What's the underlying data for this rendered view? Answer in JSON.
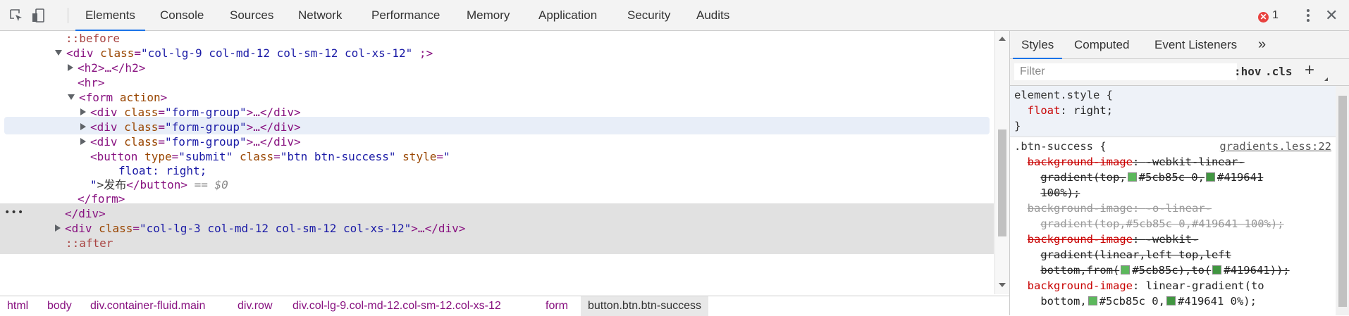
{
  "toolbar": {
    "tabs": [
      "Elements",
      "Console",
      "Sources",
      "Network",
      "Performance",
      "Memory",
      "Application",
      "Security",
      "Audits"
    ],
    "error_count": "1",
    "close_glyph": "✕"
  },
  "tree": {
    "lines": {
      "before": "::before",
      "div_main_tag": "<div",
      "div_main_attr": "class",
      "div_main_val": "\"col-lg-9 col-md-12 col-sm-12 col-xs-12\"",
      "div_main_tail": " ;>",
      "h2": "<h2>…</h2>",
      "hr": "<hr>",
      "form_tag": "<form",
      "form_attr": "action",
      "form_close": ">",
      "fg_open": "<div",
      "fg_attr": "class",
      "fg_val": "\"form-group\"",
      "fg_tail": ">…</div>",
      "btn_tag": "<button",
      "btn_type_attr": "type",
      "btn_type_val": "\"submit\"",
      "btn_class_attr": "class",
      "btn_class_val": "\"btn btn-success\"",
      "btn_style_attr": "style",
      "btn_style_open": "\"",
      "btn_style_body": "float: right;",
      "btn_style_close": "\"",
      "btn_text": ">发布",
      "btn_end": "</button>",
      "btn_eq": " == $0",
      "form_end": "</form>",
      "div_end": "</div>",
      "div2_tag": "<div",
      "div2_attr": "class",
      "div2_val": "\"col-lg-3 col-md-12 col-sm-12 col-xs-12\"",
      "div2_tail": ">…</div>",
      "after": "::after"
    }
  },
  "breadcrumb": [
    "html",
    "body",
    "div.container-fluid.main",
    "div.row",
    "div.col-lg-9.col-md-12.col-sm-12.col-xs-12",
    "form",
    "button.btn.btn-success"
  ],
  "styles": {
    "tabs": [
      "Styles",
      "Computed",
      "Event Listeners"
    ],
    "more": "»",
    "filter_placeholder": "Filter",
    "hov": ":hov",
    "cls": ".cls",
    "plus": "+",
    "element_style": {
      "selector": "element.style {",
      "prop": "float",
      "value": "right;",
      "close": "}"
    },
    "btn_success": {
      "selector": ".btn-success {",
      "source": "gradients.less:22",
      "bg1_prop": "background-image",
      "bg1_val_a": "-webkit-linear-",
      "bg1_val_b": "gradient(top,",
      "bg1_c1": "#5cb85c 0,",
      "bg1_c2": "#419641",
      "bg1_val_c": "100%);",
      "bg2_prop": "background-image",
      "bg2_val_a": "-o-linear-",
      "bg2_val_b": "gradient(top,#5cb85c 0,#419641 100%);",
      "bg3_prop": "background-image",
      "bg3_val_a": "-webkit-",
      "bg3_val_b": "gradient(linear,left top,left",
      "bg3_val_c": "bottom,from(",
      "bg3_c1": "#5cb85c),to(",
      "bg3_c2": "#419641));",
      "bg4_prop": "background-image",
      "bg4_val_a": "linear-gradient(to",
      "bg4_val_b": "bottom,",
      "bg4_c1": "#5cb85c 0,",
      "bg4_c2": "#419641 0%);"
    },
    "colors": {
      "green_light": "#5cb85c",
      "green_dark": "#419641"
    }
  }
}
